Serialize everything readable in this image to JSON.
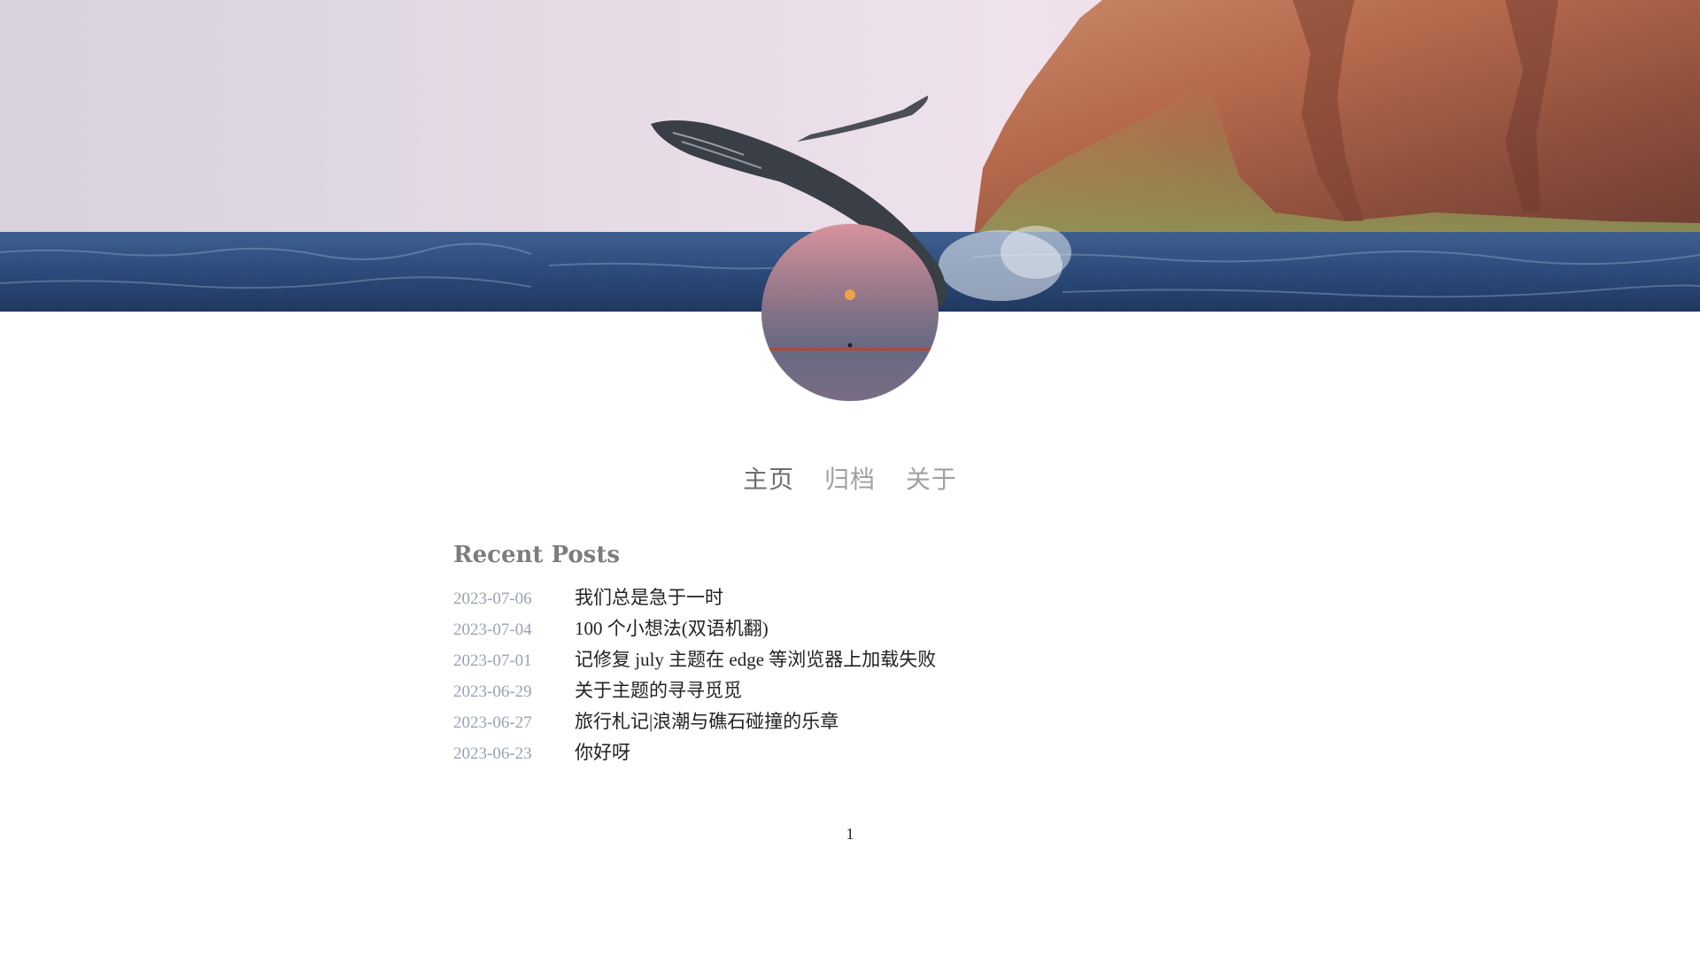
{
  "banner": {
    "image_description_icon": "whale-breach-banner-image",
    "sky_color": "#e4d8e6",
    "sea_color": "#2c4d7c"
  },
  "avatar": {
    "icon": "sunset-avatar-image",
    "top_color": "#d79aa3",
    "bottom_color": "#6c6c86"
  },
  "nav": {
    "items": [
      {
        "label": "主页"
      },
      {
        "label": "归档"
      },
      {
        "label": "关于"
      }
    ]
  },
  "recent_posts": {
    "heading": "Recent Posts",
    "posts": [
      {
        "date": "2023-07-06",
        "title": "我们总是急于一时"
      },
      {
        "date": "2023-07-04",
        "title": "100 个小想法(双语机翻)"
      },
      {
        "date": "2023-07-01",
        "title": "记修复 july 主题在 edge 等浏览器上加载失败"
      },
      {
        "date": "2023-06-29",
        "title": "关于主题的寻寻觅觅"
      },
      {
        "date": "2023-06-27",
        "title": "旅行札记|浪潮与礁石碰撞的乐章"
      },
      {
        "date": "2023-06-23",
        "title": "你好呀"
      }
    ]
  },
  "pagination": {
    "current_page": "1"
  }
}
